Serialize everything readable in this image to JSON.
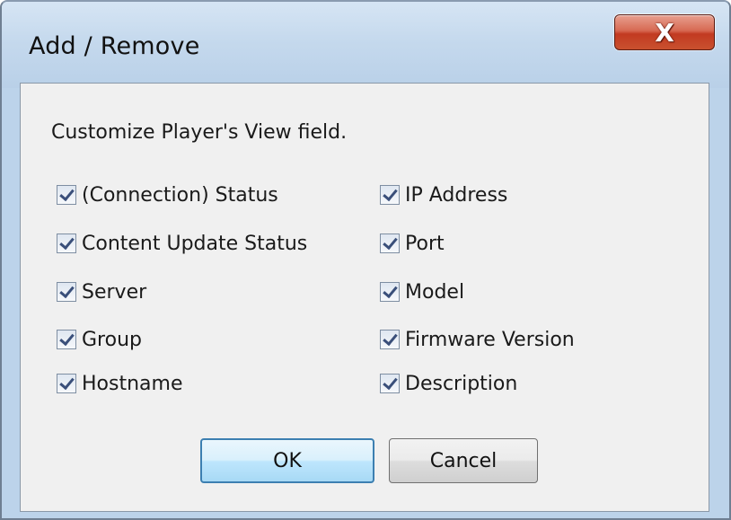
{
  "window": {
    "title": "Add / Remove",
    "close_glyph": "X"
  },
  "instruction": "Customize Player's View field.",
  "fields_left": [
    {
      "label": "(Connection) Status",
      "checked": true
    },
    {
      "label": "Content Update Status",
      "checked": true
    },
    {
      "label": "Server",
      "checked": true
    },
    {
      "label": "Group",
      "checked": true
    },
    {
      "label": "Hostname",
      "checked": true
    }
  ],
  "fields_right": [
    {
      "label": "IP Address",
      "checked": true
    },
    {
      "label": "Port",
      "checked": true
    },
    {
      "label": "Model",
      "checked": true
    },
    {
      "label": "Firmware Version",
      "checked": true
    },
    {
      "label": "Description",
      "checked": true
    }
  ],
  "buttons": {
    "ok": "OK",
    "cancel": "Cancel"
  },
  "colors": {
    "titlebar": "#c5d9ed",
    "close_button": "#c23a21",
    "client_bg": "#f0f0f0",
    "default_button_border": "#3c7fb1"
  }
}
